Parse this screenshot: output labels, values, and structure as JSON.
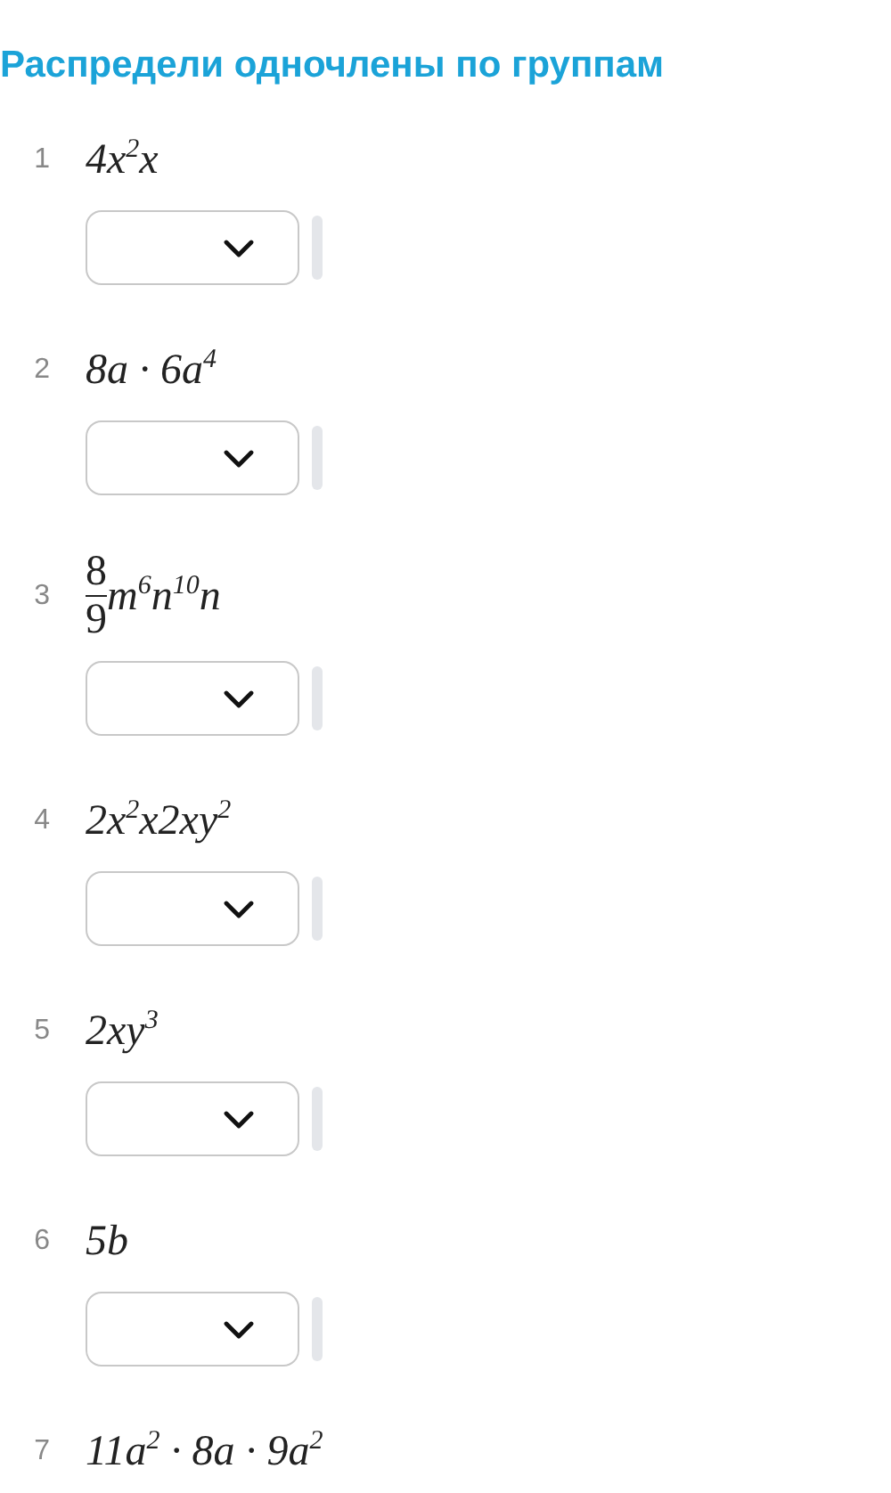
{
  "title": "Распредели одночлены по группам",
  "items": [
    {
      "number": "1",
      "expression": "4x$^{2}$x"
    },
    {
      "number": "2",
      "expression": "8a · 6a$^{4}$"
    },
    {
      "number": "3",
      "fraction": {
        "numerator": "8",
        "denominator": "9"
      },
      "expression": "m$^{6}$n$^{10}$n"
    },
    {
      "number": "4",
      "expression": "2x$^{2}$x2xy$^{2}$"
    },
    {
      "number": "5",
      "expression": "2xy$^{3}$"
    },
    {
      "number": "6",
      "expression": "5b"
    },
    {
      "number": "7",
      "expression": "11a$^{2}$ · 8a · 9a$^{2}$"
    }
  ]
}
